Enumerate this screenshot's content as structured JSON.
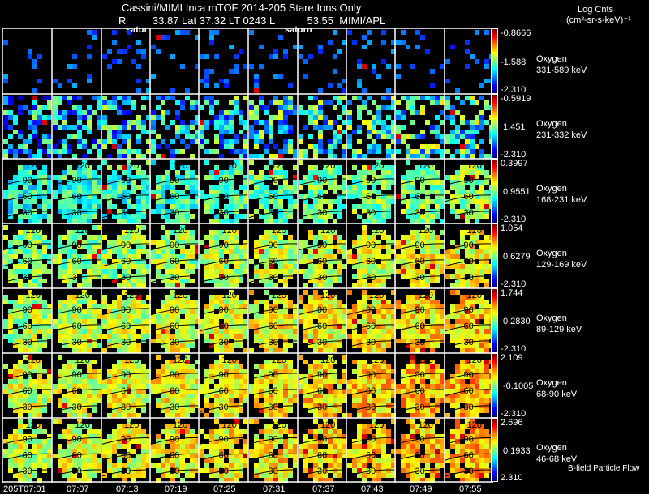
{
  "header": {
    "title": "Cassini/MIMI Inca mTOF  2014-205   Stare   Ions Only",
    "subtitle": "R         33.87 Lat 37.32 LT 0243 L           53.55  MIMI/APL",
    "overlap_label_1": "satur",
    "overlap_label_2": "saturn"
  },
  "units": {
    "line1": "Log Cnts",
    "line2": "(cm²-sr-s-keV)⁻¹"
  },
  "footer_label": "B-field Particle Flow",
  "colormap": "jet",
  "chart_data": {
    "type": "heatmap",
    "time_labels": [
      "205T07:01",
      "07:07",
      "07:13",
      "07:19",
      "07:25",
      "07:31",
      "07:37",
      "07:43",
      "07:49",
      "07:55"
    ],
    "contour_labels": [
      "120",
      "90",
      "60",
      "30"
    ],
    "rows": [
      {
        "species": "Oxygen",
        "energy": "331-589 keV",
        "max": "-0.8666",
        "mid": "-1.588",
        "min": "-2.310",
        "fill": 0.12,
        "level": 0.15
      },
      {
        "species": "Oxygen",
        "energy": "231-332 keV",
        "max": "-0.5919",
        "mid": "1.451",
        "min": "-2.310",
        "fill": 0.55,
        "level": 0.3
      },
      {
        "species": "Oxygen",
        "energy": "168-231 keV",
        "max": "0.3997",
        "mid": "0.9551",
        "min": "-2.310",
        "fill": 0.85,
        "level": 0.4
      },
      {
        "species": "Oxygen",
        "energy": "129-169 keV",
        "max": "1.054",
        "mid": "0.6279",
        "min": "-2.310",
        "fill": 0.9,
        "level": 0.5
      },
      {
        "species": "Oxygen",
        "energy": "89-129 keV",
        "max": "1.744",
        "mid": "0.2830",
        "min": "-2.310",
        "fill": 0.95,
        "level": 0.55
      },
      {
        "species": "Oxygen",
        "energy": "68-90 keV",
        "max": "2.109",
        "mid": "-0.1005",
        "min": "-2.310",
        "fill": 0.95,
        "level": 0.58
      },
      {
        "species": "Oxygen",
        "energy": "46-68 keV",
        "max": "2.696",
        "mid": "0.1933",
        "min": "2.310",
        "fill": 0.9,
        "level": 0.58
      }
    ]
  }
}
